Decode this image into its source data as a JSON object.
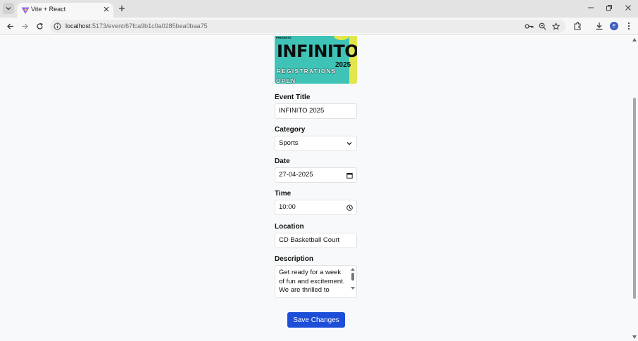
{
  "browser": {
    "tab_title": "Vite + React",
    "url_host": "localhost",
    "url_path": ":5173/event/67fca9b1c0a0285bea0baa75",
    "profile_initial": "E"
  },
  "banner": {
    "presents": "PRESENTS",
    "title": "INFINITO",
    "year": "2025",
    "registrations": "REGISTRATIONS",
    "open": "OPEN",
    "colors": {
      "background": "#3fc3b6",
      "accent": "#e3e64a"
    }
  },
  "form": {
    "event_title": {
      "label": "Event Title",
      "value": "INFINITO 2025"
    },
    "category": {
      "label": "Category",
      "value": "Sports"
    },
    "date": {
      "label": "Date",
      "value": "27-04-2025"
    },
    "time": {
      "label": "Time",
      "value": "10:00"
    },
    "location": {
      "label": "Location",
      "value": "CD Basketball Court"
    },
    "description": {
      "label": "Description",
      "value": "Get ready for a week of fun and excitement. We are thrilled to"
    },
    "save_label": "Save Changes",
    "colors": {
      "button": "#1d4ed8"
    }
  }
}
